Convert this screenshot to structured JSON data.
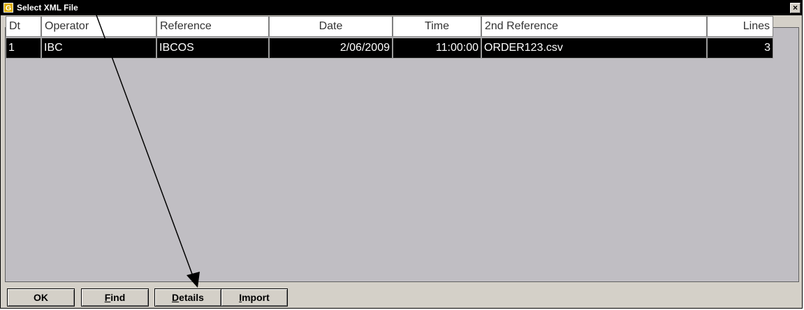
{
  "window": {
    "title": "Select XML File",
    "app_icon_letter": "G",
    "close_glyph": "×"
  },
  "grid": {
    "columns": [
      "Dt",
      "Operator",
      "Reference",
      "Date",
      "Time",
      "2nd Reference",
      "Lines"
    ],
    "rows": [
      {
        "dt": "1",
        "operator": "IBC",
        "reference": "IBCOS",
        "date": "2/06/2009",
        "time": "11:00:00",
        "second_reference": "ORDER123.csv",
        "lines": "3"
      }
    ]
  },
  "buttons": {
    "ok": "OK",
    "find_first": "F",
    "find_rest": "ind",
    "details_first": "D",
    "details_rest": "etails",
    "import_first": "I",
    "import_rest": "mport"
  },
  "annotation": {
    "type": "arrow",
    "points_to": "details-button"
  }
}
